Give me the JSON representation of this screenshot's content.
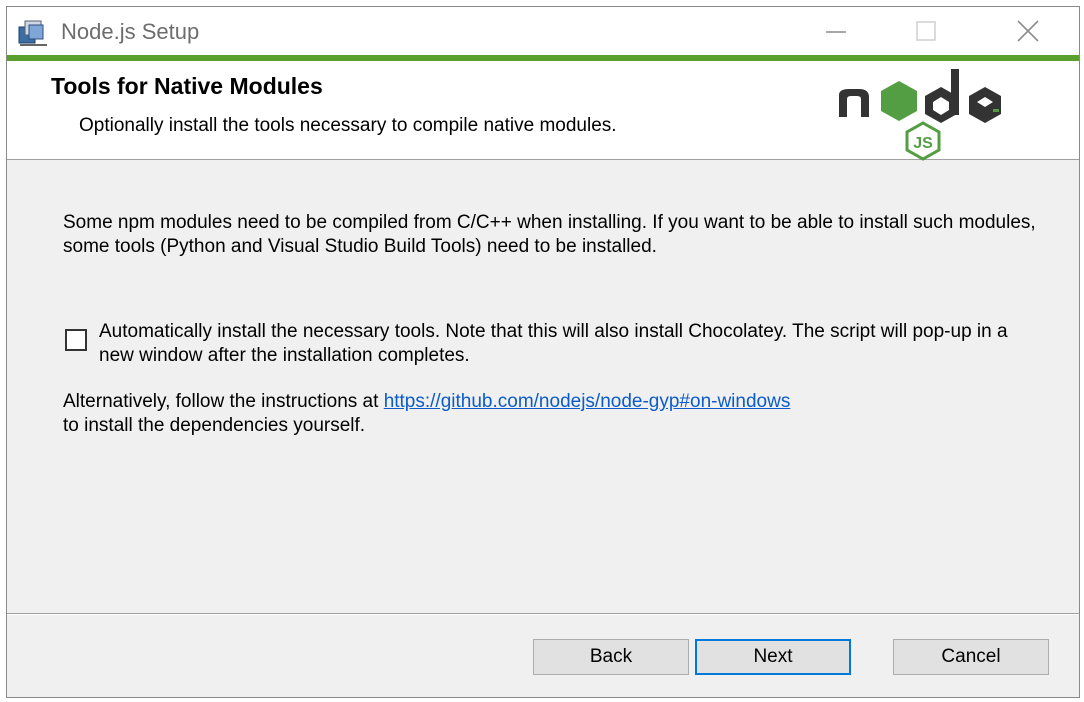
{
  "window": {
    "title": "Node.js Setup"
  },
  "header": {
    "title": "Tools for Native Modules",
    "subtitle": "Optionally install the tools necessary to compile native modules.",
    "logo_icon": "nodejs-logo"
  },
  "content": {
    "intro": "Some npm modules need to be compiled from C/C++ when installing. If you want to be able to install such modules, some tools (Python and Visual Studio Build Tools) need to be installed.",
    "checkbox": {
      "label": "Automatically install the necessary tools. Note that this will also install Chocolatey. The script will pop-up in a new window after the installation completes.",
      "checked": false
    },
    "alternative_prefix": "Alternatively, follow the instructions at",
    "alternative_link": "https://github.com/nodejs/node-gyp#on-windows",
    "alternative_suffix": "to install the dependencies yourself."
  },
  "buttons": {
    "back": "Back",
    "next": "Next",
    "cancel": "Cancel"
  },
  "colors": {
    "accent_bar": "#5aa02c",
    "node_green": "#539e43",
    "node_dark": "#333333",
    "link": "#0b5cc8",
    "default_button_border": "#0078d7"
  }
}
